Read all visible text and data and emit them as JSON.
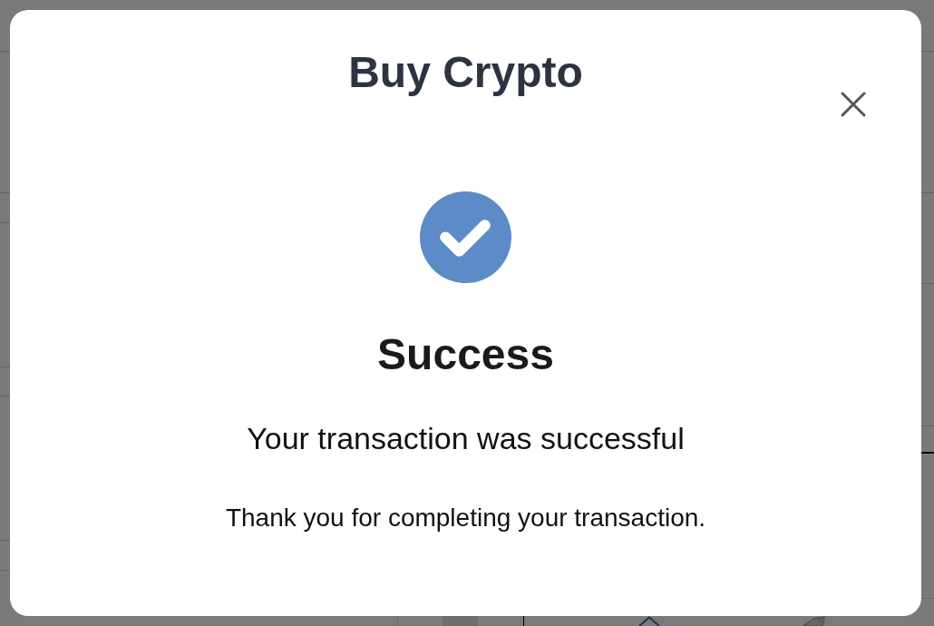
{
  "dialog": {
    "title": "Buy Crypto",
    "status": {
      "kind": "success",
      "heading": "Success",
      "message": "Your transaction was successful",
      "note": "Thank you for completing your transaction."
    }
  }
}
